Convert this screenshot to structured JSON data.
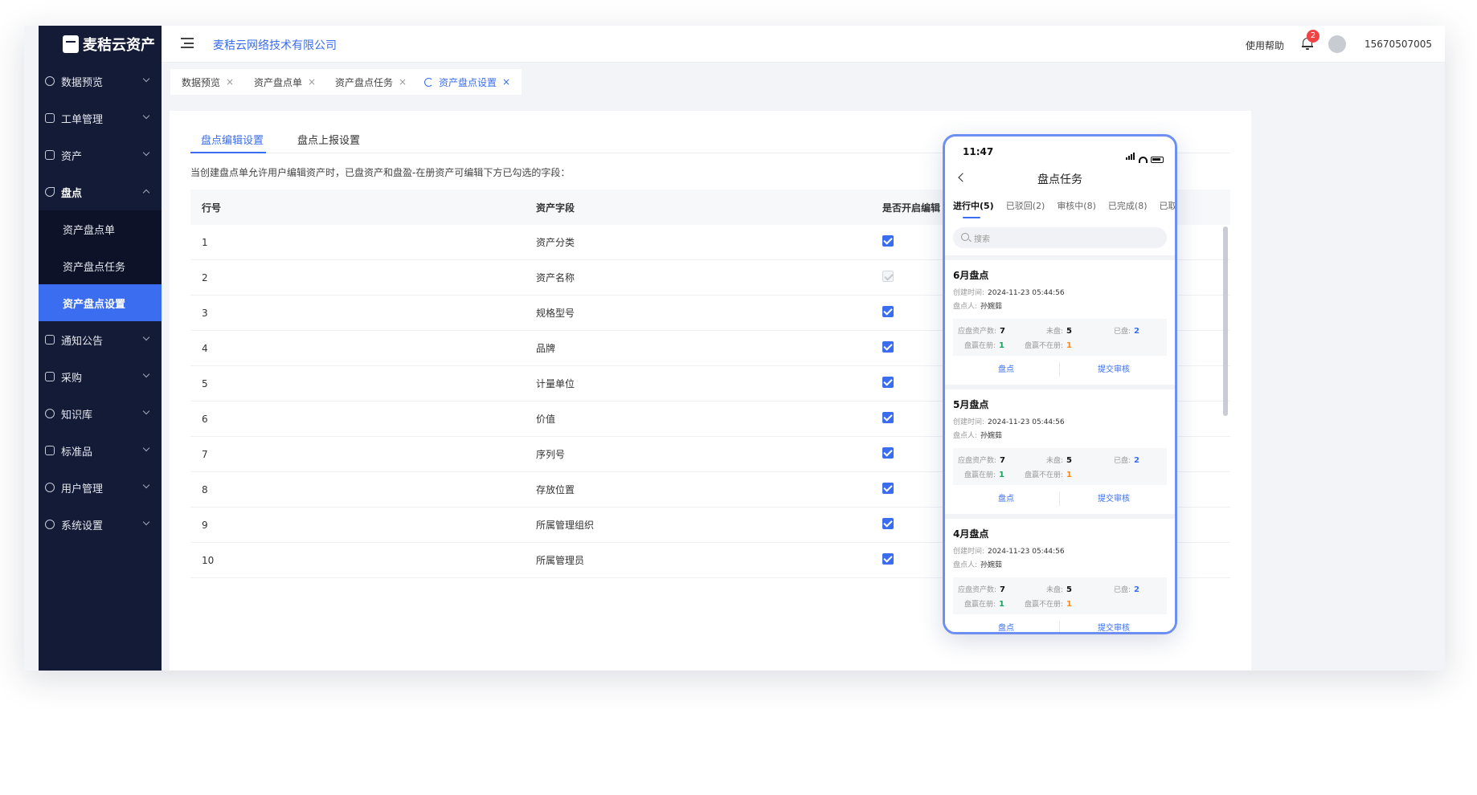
{
  "app": {
    "logo_text": "麦秸云资产",
    "company": "麦秸云网络技术有限公司",
    "help": "使用帮助",
    "notification_count": "2",
    "username": "15670507005"
  },
  "sidebar": {
    "items": [
      {
        "label": "数据预览"
      },
      {
        "label": "工单管理"
      },
      {
        "label": "资产"
      },
      {
        "label": "盘点"
      },
      {
        "label": "通知公告"
      },
      {
        "label": "采购"
      },
      {
        "label": "知识库"
      },
      {
        "label": "标准品"
      },
      {
        "label": "用户管理"
      },
      {
        "label": "系统设置"
      }
    ],
    "sub_items": [
      {
        "label": "资产盘点单"
      },
      {
        "label": "资产盘点任务"
      },
      {
        "label": "资产盘点设置"
      }
    ]
  },
  "tabs": [
    {
      "label": "数据预览"
    },
    {
      "label": "资产盘点单"
    },
    {
      "label": "资产盘点任务"
    },
    {
      "label": "资产盘点设置"
    }
  ],
  "close_glyph": "×",
  "inner_tabs": [
    {
      "label": "盘点编辑设置"
    },
    {
      "label": "盘点上报设置"
    }
  ],
  "hint": "当创建盘点单允许用户编辑资产时，已盘资产和盘盈-在册资产可编辑下方已勾选的字段：",
  "table": {
    "headers": [
      "行号",
      "资产字段",
      "是否开启编辑"
    ],
    "rows": [
      {
        "no": "1",
        "field": "资产分类",
        "checked": true,
        "disabled": false
      },
      {
        "no": "2",
        "field": "资产名称",
        "checked": true,
        "disabled": true
      },
      {
        "no": "3",
        "field": "规格型号",
        "checked": true,
        "disabled": false
      },
      {
        "no": "4",
        "field": "品牌",
        "checked": true,
        "disabled": false
      },
      {
        "no": "5",
        "field": "计量单位",
        "checked": true,
        "disabled": false
      },
      {
        "no": "6",
        "field": "价值",
        "checked": true,
        "disabled": false
      },
      {
        "no": "7",
        "field": "序列号",
        "checked": true,
        "disabled": false
      },
      {
        "no": "8",
        "field": "存放位置",
        "checked": true,
        "disabled": false
      },
      {
        "no": "9",
        "field": "所属管理组织",
        "checked": true,
        "disabled": false
      },
      {
        "no": "10",
        "field": "所属管理员",
        "checked": true,
        "disabled": false
      }
    ]
  },
  "phone": {
    "time": "11:47",
    "title": "盘点任务",
    "tabs": [
      "进行中(5)",
      "已驳回(2)",
      "审核中(8)",
      "已完成(8)",
      "已取"
    ],
    "search_placeholder": "搜索",
    "tasks": [
      {
        "name": "6月盘点",
        "created_label": "创建时间:",
        "created": "2024-11-23 05:44:56",
        "owner_label": "盘点人:",
        "owner": "孙婉茹",
        "due_label": "应盘资产数:",
        "due": "7",
        "pending_label": "未盘:",
        "pending": "5",
        "done_label": "已盘:",
        "done": "2",
        "surplus_reg_label": "盘赢在册:",
        "surplus_reg": "1",
        "surplus_unreg_label": "盘赢不在册:",
        "surplus_unreg": "1",
        "action_check": "盘点",
        "action_submit": "提交审核"
      },
      {
        "name": "5月盘点",
        "created_label": "创建时间:",
        "created": "2024-11-23 05:44:56",
        "owner_label": "盘点人:",
        "owner": "孙婉茹",
        "due_label": "应盘资产数:",
        "due": "7",
        "pending_label": "未盘:",
        "pending": "5",
        "done_label": "已盘:",
        "done": "2",
        "surplus_reg_label": "盘赢在册:",
        "surplus_reg": "1",
        "surplus_unreg_label": "盘赢不在册:",
        "surplus_unreg": "1",
        "action_check": "盘点",
        "action_submit": "提交审核"
      },
      {
        "name": "4月盘点",
        "created_label": "创建时间:",
        "created": "2024-11-23 05:44:56",
        "owner_label": "盘点人:",
        "owner": "孙婉茹",
        "due_label": "应盘资产数:",
        "due": "7",
        "pending_label": "未盘:",
        "pending": "5",
        "done_label": "已盘:",
        "done": "2",
        "surplus_reg_label": "盘赢在册:",
        "surplus_reg": "1",
        "surplus_unreg_label": "盘赢不在册:",
        "surplus_unreg": "1",
        "action_check": "盘点",
        "action_submit": "提交审核"
      }
    ]
  },
  "colors": {
    "accent": "#3a6df0",
    "sidebar_bg": "#141b37",
    "green": "#1ba25d",
    "orange": "#f08a24",
    "badge": "#f04343"
  }
}
